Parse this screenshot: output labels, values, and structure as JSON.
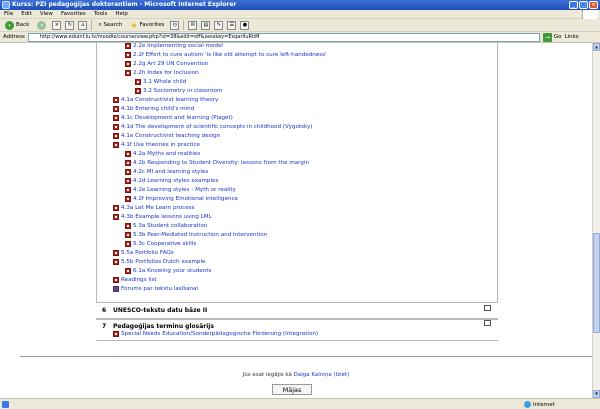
{
  "window": {
    "title": "Kurss: PZI pedagoģijas doktorantiem - Microsoft Internet Explorer",
    "minimize": "_",
    "maximize": "□",
    "close": "×"
  },
  "menu": [
    "File",
    "Edit",
    "View",
    "Favorites",
    "Tools",
    "Help"
  ],
  "toolbar": {
    "back": "Back",
    "search": "Search",
    "favorites": "Favorites"
  },
  "address": {
    "label": "Address",
    "url": "http://www.eduinf.lu.lv/moodle/course/view.php?id=38&edit=off&sesskey=EsqarIIuRhM",
    "go": "Go",
    "links": "Links"
  },
  "section5": {
    "items": [
      {
        "label": "2.2e Implementing social model",
        "icon": "doc"
      },
      {
        "label": "2.2f Effort to cure autism 'is like old attempt to cure left-handedness'",
        "icon": "doc"
      },
      {
        "label": "2.2g Art 29 UN Convention",
        "icon": "doc"
      },
      {
        "label": "2.2h Index for Inclusion",
        "icon": "doc"
      },
      {
        "label": "3.1 Whole child",
        "icon": "doc"
      },
      {
        "label": "3.2 Sociometry in classroom",
        "icon": "doc"
      },
      {
        "label": "4.1a Constructivist learning theory",
        "icon": "doc"
      },
      {
        "label": "4.1b Entering child's mind",
        "icon": "doc"
      },
      {
        "label": "4.1c Development and learning (Piaget)",
        "icon": "doc"
      },
      {
        "label": "4.1d The development of scientific concepts in childhood (Vygotsky)",
        "icon": "doc"
      },
      {
        "label": "4.1e Constructivist teaching design",
        "icon": "doc"
      },
      {
        "label": "4.1f Use theories in practice",
        "icon": "doc"
      },
      {
        "label": "4.2a Myths and realities",
        "icon": "doc"
      },
      {
        "label": "4.2b Responding to Student Diversity: lessons from the margin",
        "icon": "doc"
      },
      {
        "label": "4.2c MI and learning styles",
        "icon": "doc"
      },
      {
        "label": "4.2d Learning styles examples",
        "icon": "doc"
      },
      {
        "label": "4.2e Learning styles - Myth or reality",
        "icon": "doc"
      },
      {
        "label": "4.2f Improving Emotional intelligence",
        "icon": "doc"
      },
      {
        "label": "4.3a Let Me Learn process",
        "icon": "doc"
      },
      {
        "label": "4.3b Example lessons using LML",
        "icon": "doc"
      },
      {
        "label": "5.3a Student collaboration",
        "icon": "doc"
      },
      {
        "label": "5.3b Peer-Mediated Instruction and Intervention",
        "icon": "doc"
      },
      {
        "label": "5.3c Cooperative skills",
        "icon": "doc"
      },
      {
        "label": "5.5a Portfolio FAQs",
        "icon": "doc"
      },
      {
        "label": "5.5b Portfolios Dutch example",
        "icon": "doc"
      },
      {
        "label": "6.1a Knowing your students",
        "icon": "doc"
      },
      {
        "label": "Readings list",
        "icon": "doc"
      },
      {
        "label": "Forums par tekstu lasīšanai",
        "icon": "forum"
      }
    ]
  },
  "section6": {
    "number": "6",
    "title": "UNESCO-tekstu datu bāze II"
  },
  "section7": {
    "number": "7",
    "title": "Pedagoģijas terminu glosārijs",
    "items": [
      {
        "label": "Special Needs Education/Sonderpädagogische Förderung (Integration)",
        "icon": "doc"
      }
    ]
  },
  "footer": {
    "logged_prefix": "Jūs esat iegājis kā",
    "user": "Daiga Kalniņa",
    "logout": "(Iziet)",
    "home": "Mājas"
  },
  "status": {
    "zone": "Internet"
  }
}
